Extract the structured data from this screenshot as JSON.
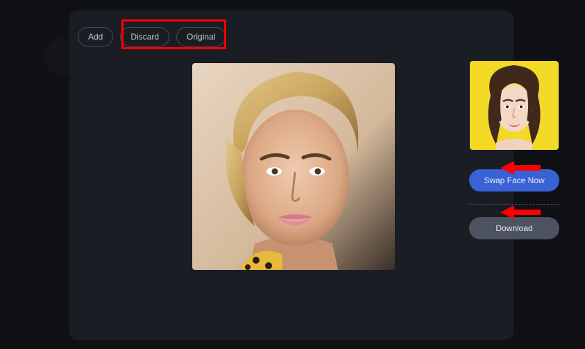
{
  "toolbar": {
    "add_label": "Add",
    "discard_label": "Discard",
    "original_label": "Original"
  },
  "actions": {
    "swap_label": "Swap Face Now",
    "download_label": "Download"
  }
}
